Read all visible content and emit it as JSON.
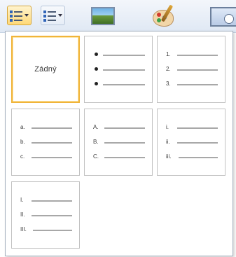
{
  "ribbon": {
    "bullets_button": {
      "icon": "bulleted-list-icon",
      "active": true
    },
    "numbering_button": {
      "icon": "numbered-list-icon"
    },
    "picture_icon": "picture-icon",
    "clipart_icon": "clip-art-icon",
    "datetime_icon": "date-time-icon"
  },
  "gallery": {
    "none_label": "Zádný",
    "tiles": [
      {
        "id": "none",
        "selected": true
      },
      {
        "id": "bullet-dots",
        "markers": [
          "",
          "",
          ""
        ],
        "bullet": true
      },
      {
        "id": "numbers-arabic",
        "markers": [
          "1.",
          "2.",
          "3."
        ]
      },
      {
        "id": "letters-lower",
        "markers": [
          "a.",
          "b.",
          "c."
        ]
      },
      {
        "id": "letters-upper",
        "markers": [
          "A.",
          "B.",
          "C."
        ]
      },
      {
        "id": "roman-lower",
        "markers": [
          "i.",
          "ii.",
          "iii."
        ]
      },
      {
        "id": "roman-upper",
        "markers": [
          "I.",
          "II.",
          "III."
        ]
      }
    ]
  },
  "colors": {
    "selection_border": "#f0b43a",
    "tile_border": "#c2c2c2",
    "line": "#a8a8a8"
  }
}
